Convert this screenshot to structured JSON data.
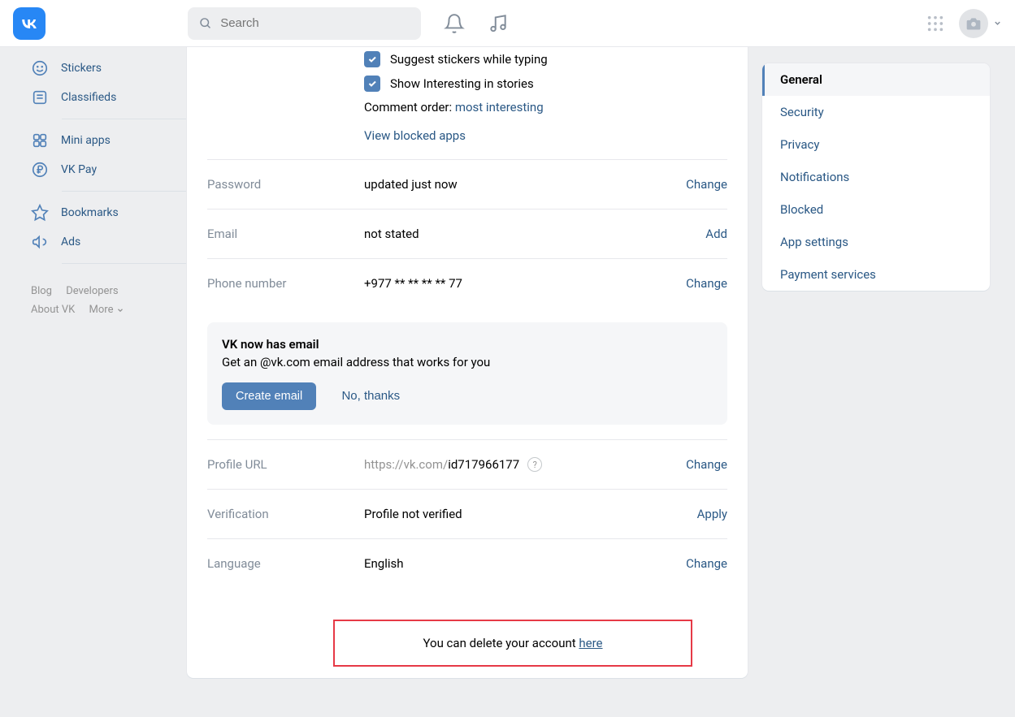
{
  "header": {
    "search_placeholder": "Search"
  },
  "sidebar": {
    "items": [
      {
        "label": "Stickers"
      },
      {
        "label": "Classifieds"
      },
      {
        "label": "Mini apps"
      },
      {
        "label": "VK Pay"
      },
      {
        "label": "Bookmarks"
      },
      {
        "label": "Ads"
      }
    ],
    "footer": {
      "blog": "Blog",
      "developers": "Developers",
      "about": "About VK",
      "more": "More"
    }
  },
  "settings": {
    "checkbox_suggest": "Suggest stickers while typing",
    "checkbox_interesting": "Show Interesting in stories",
    "comment_order_label": "Comment order: ",
    "comment_order_value": "most interesting",
    "view_blocked": "View blocked apps",
    "password": {
      "label": "Password",
      "value": "updated just now",
      "action": "Change"
    },
    "email": {
      "label": "Email",
      "value": "not stated",
      "action": "Add"
    },
    "phone": {
      "label": "Phone number",
      "value": "+977 ** ** ** ** 77",
      "action": "Change"
    },
    "promo": {
      "title": "VK now has email",
      "desc": "Get an @vk.com email address that works for you",
      "create": "Create email",
      "no_thanks": "No, thanks"
    },
    "profile_url": {
      "label": "Profile URL",
      "prefix": "https://vk.com/",
      "id": "id717966177",
      "action": "Change",
      "help": "?"
    },
    "verification": {
      "label": "Verification",
      "value": "Profile not verified",
      "action": "Apply"
    },
    "language": {
      "label": "Language",
      "value": "English",
      "action": "Change"
    },
    "delete": {
      "text": "You can delete your account ",
      "link": "here"
    }
  },
  "rail": {
    "items": [
      {
        "label": "General"
      },
      {
        "label": "Security"
      },
      {
        "label": "Privacy"
      },
      {
        "label": "Notifications"
      },
      {
        "label": "Blocked"
      },
      {
        "label": "App settings"
      },
      {
        "label": "Payment services"
      }
    ]
  }
}
